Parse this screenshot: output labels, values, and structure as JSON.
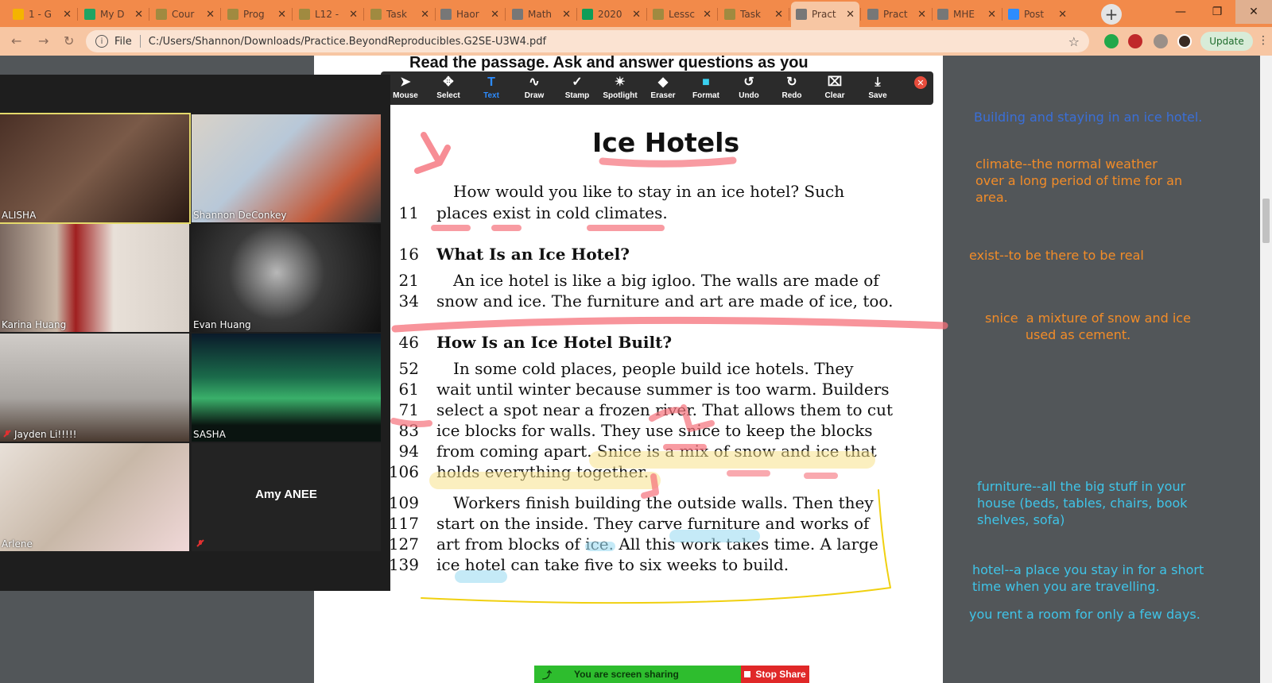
{
  "browser": {
    "tabs": [
      {
        "label": "1 - G",
        "color": "#f4b400"
      },
      {
        "label": "My D",
        "color": "#1fa463"
      },
      {
        "label": "Cour",
        "color": "#a08a40"
      },
      {
        "label": "Prog",
        "color": "#a08a40"
      },
      {
        "label": "L12 -",
        "color": "#a08a40"
      },
      {
        "label": "Task",
        "color": "#a08a40"
      },
      {
        "label": "Haor",
        "color": "#777777"
      },
      {
        "label": "Math",
        "color": "#777777"
      },
      {
        "label": "2020",
        "color": "#0f9d58"
      },
      {
        "label": "Lessc",
        "color": "#a08a40"
      },
      {
        "label": "Task",
        "color": "#a08a40"
      },
      {
        "label": "Pract",
        "color": "#777777"
      },
      {
        "label": "Pract",
        "color": "#777777"
      },
      {
        "label": "MHE",
        "color": "#777777"
      },
      {
        "label": "Post",
        "color": "#2d8cff"
      }
    ],
    "address_scheme": "File",
    "address_url": "C:/Users/Shannon/Downloads/Practice.BeyondReproducibles.G2SE-U3W4.pdf",
    "update_label": "Update"
  },
  "annotate_toolbar": {
    "tools": [
      {
        "label": "Mouse",
        "icon": "pointer-icon"
      },
      {
        "label": "Select",
        "icon": "move-icon"
      },
      {
        "label": "Text",
        "icon": "text-icon"
      },
      {
        "label": "Draw",
        "icon": "draw-icon"
      },
      {
        "label": "Stamp",
        "icon": "check-icon"
      },
      {
        "label": "Spotlight",
        "icon": "spotlight-icon"
      },
      {
        "label": "Eraser",
        "icon": "eraser-icon"
      },
      {
        "label": "Format",
        "icon": "format-icon"
      },
      {
        "label": "Undo",
        "icon": "undo-icon"
      },
      {
        "label": "Redo",
        "icon": "redo-icon"
      },
      {
        "label": "Clear",
        "icon": "trash-icon"
      },
      {
        "label": "Save",
        "icon": "save-icon"
      }
    ],
    "active_tool": "Text",
    "active_color": "#2d8cff"
  },
  "participants": [
    {
      "name": "ALISHA"
    },
    {
      "name": "Shannon DeConkey"
    },
    {
      "name": "Karina Huang"
    },
    {
      "name": "Evan Huang"
    },
    {
      "name": "Jayden Li!!!!!"
    },
    {
      "name": "SASHA"
    },
    {
      "name": "Arlene"
    },
    {
      "name": "Amy ANEE"
    }
  ],
  "pdf": {
    "instruction": "Read the passage. Ask and answer questions as you",
    "title": "Ice Hotels",
    "lines": [
      {
        "num": "",
        "text": "How would you like to stay in an ice hotel? Such"
      },
      {
        "num": "11",
        "text": "places exist in cold climates."
      },
      {
        "num": "16",
        "text": "What Is an Ice Hotel?"
      },
      {
        "num": "21",
        "text": "An ice hotel is like a big igloo. The walls are made of"
      },
      {
        "num": "34",
        "text": "snow and ice. The furniture and art are made of ice, too."
      },
      {
        "num": "46",
        "text": "How Is an Ice Hotel Built?"
      },
      {
        "num": "52",
        "text": "In some cold places, people build ice hotels. They"
      },
      {
        "num": "61",
        "text": "wait until winter because summer is too warm. Builders"
      },
      {
        "num": "71",
        "text": "select a spot near a frozen river. That allows them to cut"
      },
      {
        "num": "83",
        "text": "ice blocks for walls. They use snice to keep the blocks"
      },
      {
        "num": "94",
        "text": "from coming apart. Snice is a mix of snow and ice that"
      },
      {
        "num": "106",
        "text": "holds everything together."
      },
      {
        "num": "109",
        "text": "Workers finish building the outside walls. Then they"
      },
      {
        "num": "117",
        "text": "start on the inside. They carve furniture and works of"
      },
      {
        "num": "127",
        "text": "art from blocks of ice. All this work takes time. A large"
      },
      {
        "num": "139",
        "text": "ice hotel can take five to six weeks to build."
      }
    ]
  },
  "notes": [
    {
      "text": "Building and staying in an ice hotel.",
      "color": "#3a6fd8"
    },
    {
      "text": "climate--the normal weather\nover a long period of time for an\narea.",
      "color": "#f28c28"
    },
    {
      "text": "exist--to be there to be real",
      "color": "#f28c28"
    },
    {
      "text": "snice  a mixture of snow and ice\n          used as cement.",
      "color": "#f28c28"
    },
    {
      "text": "furniture--all the big stuff in your\nhouse (beds, tables, chairs, book\nshelves, sofa)",
      "color": "#3fc4e8"
    },
    {
      "text": "hotel--a place you stay in for a short\ntime when you are travelling.",
      "color": "#3fc4e8"
    },
    {
      "text": "you rent a room for only a few days.",
      "color": "#3fc4e8"
    }
  ],
  "share_banner": {
    "status": "You are screen sharing",
    "stop_label": "Stop Share"
  }
}
